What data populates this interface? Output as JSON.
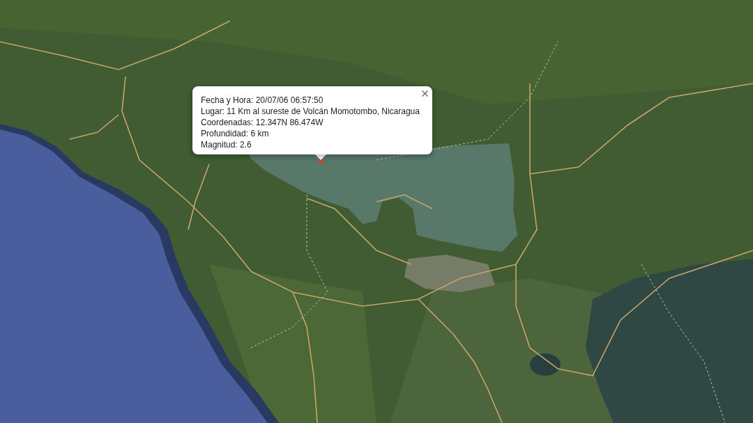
{
  "map": {
    "info_window": {
      "date_time": "Fecha y Hora: 20/07/06 06:57:50",
      "location": "Lugar: 11 Km al sureste de Volcán Momotombo, Nicaragua",
      "coordinates": "Coordenadas: 12.347N 86.474W",
      "depth": "Profundidad: 6 km",
      "magnitude": "Magnitud: 2.6"
    }
  }
}
